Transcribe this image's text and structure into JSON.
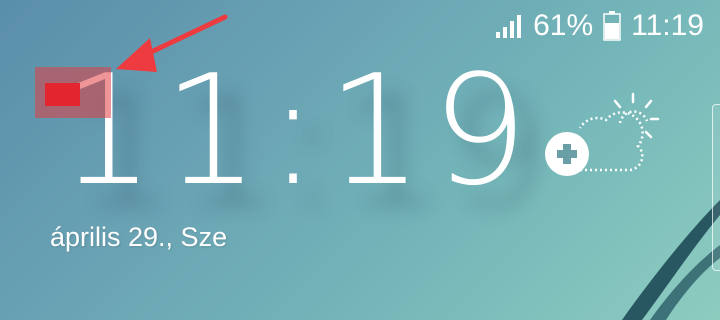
{
  "status_bar": {
    "battery_percent": "61%",
    "time": "11:19",
    "signal_icon": "signal-bars-icon",
    "battery_icon": "battery-icon"
  },
  "lock_screen": {
    "clock": "11:19",
    "date": "április 29., Sze"
  },
  "weather_widget": {
    "icon": "partly-sunny-icon",
    "add_icon": "plus-icon"
  },
  "annotation": {
    "color": "#e3252f",
    "arrow_icon": "arrow-icon"
  },
  "colors": {
    "wallpaper_start": "#5a8eaa",
    "wallpaper_end": "#8dccbf",
    "text": "#ffffff"
  }
}
